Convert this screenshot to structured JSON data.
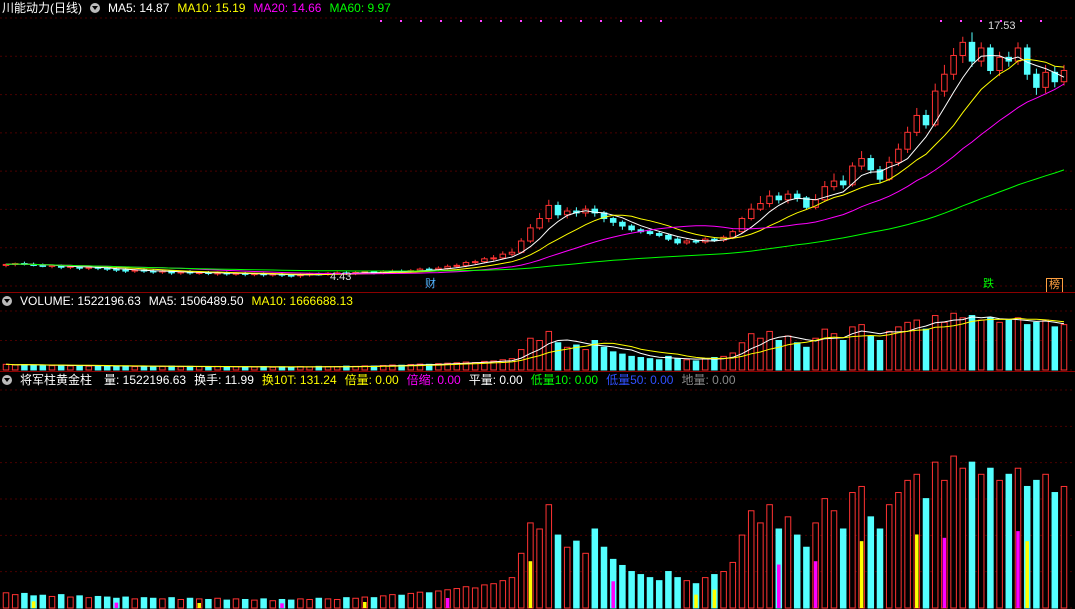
{
  "colors": {
    "up": "#ff3232",
    "down": "#54ffff",
    "ma5": "#ffffff",
    "ma10": "#ffff00",
    "ma20": "#ff00ff",
    "ma60": "#00ff00",
    "border": "#8b0000"
  },
  "main": {
    "title": "川能动力(日线)",
    "ma": [
      {
        "label": "MA5: 14.87",
        "color": "#ffffff"
      },
      {
        "label": "MA10: 15.19",
        "color": "#ffff00"
      },
      {
        "label": "MA20: 14.66",
        "color": "#ff00ff"
      },
      {
        "label": "MA60: 9.97",
        "color": "#00ff00"
      }
    ],
    "high_label": "17.53",
    "low_label": "4.43",
    "event_tags": [
      {
        "text": "财",
        "color": "#54b4ff"
      },
      {
        "text": "跌",
        "color": "#00ff00"
      },
      {
        "text": "榜",
        "color": "#ffa040"
      }
    ]
  },
  "volume": {
    "items": [
      {
        "label": "VOLUME: 1522196.63",
        "color": "#ffffff"
      },
      {
        "label": "MA5: 1506489.50",
        "color": "#ffffff"
      },
      {
        "label": "MA10: 1666688.13",
        "color": "#ffff00"
      }
    ]
  },
  "indicator": {
    "items": [
      {
        "label": "将军柱黄金柱",
        "color": "#ffffff"
      },
      {
        "label": "量: 1522196.63",
        "color": "#ffffff"
      },
      {
        "label": "换手: 11.99",
        "color": "#ffffff"
      },
      {
        "label": "换10T: 131.24",
        "color": "#ffff00"
      },
      {
        "label": "倍量: 0.00",
        "color": "#ffff00"
      },
      {
        "label": "倍缩: 0.00",
        "color": "#ff00ff"
      },
      {
        "label": "平量: 0.00",
        "color": "#ffffff"
      },
      {
        "label": "低量10: 0.00",
        "color": "#00ff00"
      },
      {
        "label": "低量50: 0.00",
        "color": "#0000ff"
      },
      {
        "label": "地量: 0.00",
        "color": "#888888"
      }
    ]
  },
  "chart_data": {
    "type": "candlestick",
    "title": "川能动力(日线)",
    "ylim": [
      4.0,
      18.3
    ],
    "candles": [
      [
        5.1,
        5.15,
        5.05,
        5.0,
        5.2
      ],
      [
        5.15,
        5.2,
        5.1,
        5.05,
        5.25
      ],
      [
        5.2,
        5.15,
        5.2,
        5.1,
        5.3
      ],
      [
        5.15,
        5.1,
        5.15,
        5.05,
        5.25
      ],
      [
        5.1,
        5.05,
        5.1,
        5.0,
        5.2
      ],
      [
        5.05,
        5.1,
        5.05,
        4.95,
        5.15
      ],
      [
        5.1,
        5.0,
        5.1,
        4.9,
        5.15
      ],
      [
        5.0,
        5.05,
        5.0,
        4.9,
        5.1
      ],
      [
        5.05,
        4.95,
        5.05,
        4.85,
        5.1
      ],
      [
        4.95,
        5.0,
        4.95,
        4.85,
        5.05
      ],
      [
        5.0,
        4.95,
        5.0,
        4.85,
        5.05
      ],
      [
        4.95,
        4.9,
        4.95,
        4.8,
        5.05
      ],
      [
        4.9,
        4.85,
        4.9,
        4.75,
        5.0
      ],
      [
        4.85,
        4.8,
        4.85,
        4.7,
        4.95
      ],
      [
        4.8,
        4.85,
        4.8,
        4.7,
        4.9
      ],
      [
        4.85,
        4.8,
        4.85,
        4.7,
        4.95
      ],
      [
        4.8,
        4.75,
        4.8,
        4.65,
        4.9
      ],
      [
        4.75,
        4.8,
        4.75,
        4.65,
        4.85
      ],
      [
        4.8,
        4.7,
        4.8,
        4.6,
        4.85
      ],
      [
        4.7,
        4.75,
        4.7,
        4.6,
        4.8
      ],
      [
        4.75,
        4.7,
        4.75,
        4.6,
        4.85
      ],
      [
        4.7,
        4.72,
        4.7,
        4.6,
        4.8
      ],
      [
        4.72,
        4.68,
        4.72,
        4.58,
        4.8
      ],
      [
        4.68,
        4.7,
        4.68,
        4.55,
        4.78
      ],
      [
        4.7,
        4.65,
        4.7,
        4.55,
        4.78
      ],
      [
        4.65,
        4.68,
        4.65,
        4.55,
        4.75
      ],
      [
        4.68,
        4.62,
        4.68,
        4.52,
        4.75
      ],
      [
        4.62,
        4.66,
        4.62,
        4.52,
        4.72
      ],
      [
        4.66,
        4.6,
        4.66,
        4.5,
        4.72
      ],
      [
        4.6,
        4.64,
        4.6,
        4.5,
        4.7
      ],
      [
        4.64,
        4.58,
        4.64,
        4.48,
        4.7
      ],
      [
        4.58,
        4.55,
        4.58,
        4.45,
        4.65
      ],
      [
        4.55,
        4.6,
        4.55,
        4.43,
        4.66
      ],
      [
        4.6,
        4.65,
        4.6,
        4.5,
        4.72
      ],
      [
        4.65,
        4.62,
        4.65,
        4.55,
        4.72
      ],
      [
        4.62,
        4.68,
        4.62,
        4.55,
        4.75
      ],
      [
        4.68,
        4.7,
        4.68,
        4.6,
        4.78
      ],
      [
        4.7,
        4.66,
        4.7,
        4.58,
        4.78
      ],
      [
        4.66,
        4.72,
        4.66,
        4.58,
        4.8
      ],
      [
        4.72,
        4.75,
        4.72,
        4.65,
        4.82
      ],
      [
        4.75,
        4.7,
        4.75,
        4.62,
        4.82
      ],
      [
        4.7,
        4.78,
        4.7,
        4.62,
        4.85
      ],
      [
        4.78,
        4.8,
        4.78,
        4.7,
        4.88
      ],
      [
        4.8,
        4.76,
        4.8,
        4.68,
        4.88
      ],
      [
        4.76,
        4.82,
        4.76,
        4.68,
        4.9
      ],
      [
        4.82,
        4.9,
        4.82,
        4.75,
        4.98
      ],
      [
        4.9,
        4.88,
        4.9,
        4.8,
        5.0
      ],
      [
        4.88,
        4.95,
        4.88,
        4.8,
        5.05
      ],
      [
        4.95,
        5.05,
        4.95,
        4.88,
        5.15
      ],
      [
        5.05,
        5.1,
        5.05,
        4.98,
        5.2
      ],
      [
        5.1,
        5.25,
        5.1,
        5.0,
        5.35
      ],
      [
        5.25,
        5.3,
        5.25,
        5.15,
        5.4
      ],
      [
        5.3,
        5.45,
        5.3,
        5.2,
        5.55
      ],
      [
        5.45,
        5.5,
        5.45,
        5.35,
        5.65
      ],
      [
        5.5,
        5.7,
        5.5,
        5.4,
        5.85
      ],
      [
        5.7,
        5.8,
        5.7,
        5.6,
        6.0
      ],
      [
        5.8,
        6.4,
        5.8,
        5.75,
        6.55
      ],
      [
        6.4,
        7.1,
        6.4,
        6.3,
        7.3
      ],
      [
        7.1,
        7.6,
        7.1,
        7.0,
        7.9
      ],
      [
        7.6,
        8.3,
        7.6,
        7.4,
        8.6
      ],
      [
        8.3,
        7.8,
        8.3,
        7.6,
        8.5
      ],
      [
        7.8,
        8.0,
        7.8,
        7.6,
        8.2
      ],
      [
        8.0,
        7.9,
        8.0,
        7.7,
        8.2
      ],
      [
        7.9,
        8.1,
        7.9,
        7.7,
        8.3
      ],
      [
        8.1,
        7.9,
        8.1,
        7.7,
        8.3
      ],
      [
        7.9,
        7.6,
        7.9,
        7.4,
        8.0
      ],
      [
        7.6,
        7.4,
        7.6,
        7.2,
        7.7
      ],
      [
        7.4,
        7.2,
        7.4,
        7.0,
        7.5
      ],
      [
        7.2,
        7.0,
        7.2,
        6.9,
        7.3
      ],
      [
        7.0,
        6.9,
        7.0,
        6.8,
        7.1
      ],
      [
        6.9,
        6.8,
        6.9,
        6.7,
        7.0
      ],
      [
        6.8,
        6.7,
        6.8,
        6.6,
        6.9
      ],
      [
        6.7,
        6.5,
        6.7,
        6.4,
        6.8
      ],
      [
        6.5,
        6.3,
        6.5,
        6.2,
        6.6
      ],
      [
        6.3,
        6.4,
        6.3,
        6.2,
        6.5
      ],
      [
        6.4,
        6.35,
        6.4,
        6.25,
        6.5
      ],
      [
        6.35,
        6.5,
        6.35,
        6.25,
        6.6
      ],
      [
        6.5,
        6.45,
        6.5,
        6.35,
        6.6
      ],
      [
        6.45,
        6.6,
        6.45,
        6.35,
        6.7
      ],
      [
        6.6,
        6.9,
        6.6,
        6.5,
        7.0
      ],
      [
        6.9,
        7.6,
        6.9,
        6.8,
        7.7
      ],
      [
        7.6,
        8.1,
        7.6,
        7.5,
        8.4
      ],
      [
        8.1,
        8.4,
        8.1,
        8.0,
        8.8
      ],
      [
        8.4,
        8.8,
        8.4,
        8.2,
        9.1
      ],
      [
        8.8,
        8.6,
        8.8,
        8.4,
        9.0
      ],
      [
        8.6,
        8.9,
        8.6,
        8.4,
        9.1
      ],
      [
        8.9,
        8.7,
        8.9,
        8.5,
        9.1
      ],
      [
        8.7,
        8.2,
        8.7,
        8.1,
        8.8
      ],
      [
        8.2,
        8.6,
        8.2,
        8.1,
        8.9
      ],
      [
        8.6,
        9.3,
        8.6,
        8.5,
        9.6
      ],
      [
        9.3,
        9.6,
        9.3,
        9.1,
        10.0
      ],
      [
        9.6,
        9.4,
        9.6,
        9.2,
        9.9
      ],
      [
        9.4,
        10.4,
        9.4,
        9.3,
        10.6
      ],
      [
        10.4,
        10.8,
        10.4,
        10.2,
        11.2
      ],
      [
        10.8,
        10.2,
        10.8,
        10.0,
        11.0
      ],
      [
        10.2,
        9.7,
        10.2,
        9.5,
        10.4
      ],
      [
        9.7,
        10.6,
        9.7,
        9.6,
        10.9
      ],
      [
        10.6,
        11.3,
        10.6,
        10.4,
        11.6
      ],
      [
        11.3,
        12.2,
        11.3,
        11.1,
        12.5
      ],
      [
        12.2,
        13.1,
        12.2,
        12.0,
        13.5
      ],
      [
        13.1,
        12.6,
        13.1,
        12.4,
        13.4
      ],
      [
        12.6,
        14.4,
        12.6,
        12.5,
        14.8
      ],
      [
        14.4,
        15.3,
        14.4,
        14.1,
        15.8
      ],
      [
        15.3,
        16.3,
        15.3,
        15.0,
        16.7
      ],
      [
        16.3,
        17.0,
        16.3,
        15.9,
        17.3
      ],
      [
        17.0,
        16.0,
        17.0,
        15.7,
        17.53
      ],
      [
        16.0,
        16.7,
        16.0,
        15.7,
        17.0
      ],
      [
        16.7,
        15.5,
        16.7,
        15.3,
        16.9
      ],
      [
        15.5,
        16.2,
        15.5,
        15.2,
        16.5
      ],
      [
        16.2,
        16.0,
        16.2,
        15.7,
        16.5
      ],
      [
        16.0,
        16.7,
        16.0,
        15.8,
        17.0
      ],
      [
        16.7,
        15.3,
        16.7,
        15.0,
        16.9
      ],
      [
        15.3,
        14.6,
        15.3,
        14.2,
        15.6
      ],
      [
        14.6,
        15.4,
        14.6,
        14.3,
        15.8
      ],
      [
        15.4,
        14.9,
        15.4,
        14.6,
        15.7
      ],
      [
        14.9,
        15.5,
        14.9,
        14.7,
        15.8
      ]
    ],
    "volume": [
      0.25,
      0.22,
      0.24,
      0.2,
      0.21,
      0.19,
      0.22,
      0.18,
      0.2,
      0.17,
      0.19,
      0.18,
      0.16,
      0.18,
      0.15,
      0.17,
      0.16,
      0.15,
      0.17,
      0.14,
      0.16,
      0.15,
      0.14,
      0.16,
      0.13,
      0.15,
      0.14,
      0.13,
      0.15,
      0.12,
      0.14,
      0.13,
      0.15,
      0.14,
      0.16,
      0.15,
      0.14,
      0.17,
      0.16,
      0.18,
      0.17,
      0.2,
      0.22,
      0.21,
      0.24,
      0.26,
      0.25,
      0.28,
      0.3,
      0.32,
      0.35,
      0.33,
      0.38,
      0.4,
      0.45,
      0.5,
      0.9,
      1.4,
      1.3,
      1.7,
      1.2,
      1.0,
      1.1,
      0.9,
      1.3,
      1.0,
      0.8,
      0.7,
      0.6,
      0.55,
      0.5,
      0.45,
      0.6,
      0.5,
      0.45,
      0.4,
      0.5,
      0.55,
      0.6,
      0.75,
      1.2,
      1.6,
      1.4,
      1.7,
      1.3,
      1.5,
      1.2,
      1.0,
      1.4,
      1.8,
      1.6,
      1.3,
      1.9,
      2.0,
      1.5,
      1.3,
      1.7,
      1.9,
      2.1,
      2.2,
      1.8,
      2.4,
      2.1,
      2.5,
      2.3,
      2.4,
      2.2,
      2.3,
      2.1,
      2.2,
      2.3,
      2.0,
      2.1,
      2.2,
      1.9,
      2.0
    ],
    "vol_max": 2.6
  }
}
